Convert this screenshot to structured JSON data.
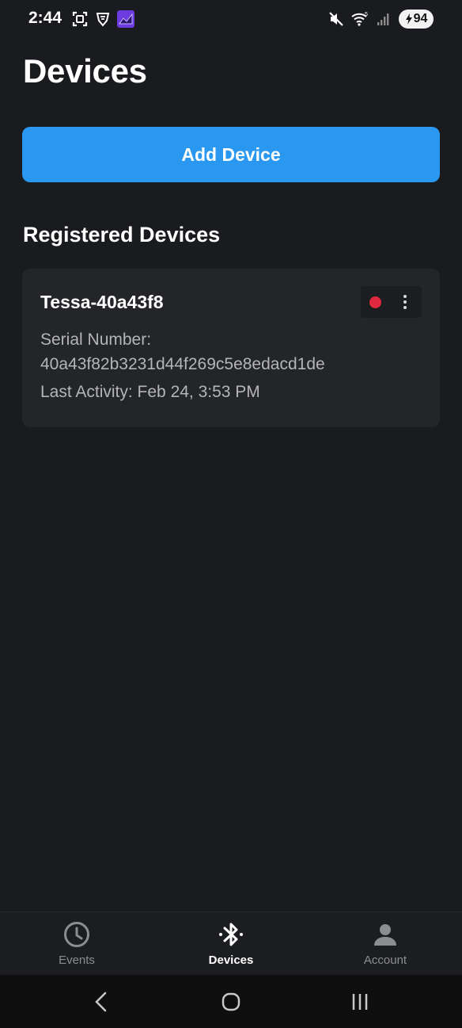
{
  "status_bar": {
    "time": "2:44",
    "battery": "94",
    "icons_left": [
      "screenshot-icon",
      "vpn-shield-icon",
      "app-chart-icon"
    ],
    "icons_right": [
      "mute-icon",
      "wifi-icon",
      "signal-icon",
      "battery-charging-icon"
    ],
    "wifi_badge": "5"
  },
  "page": {
    "title": "Devices"
  },
  "add_button": {
    "label": "Add Device",
    "color": "#2a97f0"
  },
  "registered": {
    "heading": "Registered Devices",
    "devices": [
      {
        "name": "Tessa-40a43f8",
        "serial_label": "Serial Number:",
        "serial_value": "40a43f82b3231d44f269c5e8edacd1de",
        "last_activity": "Last Activity: Feb 24, 3:53 PM",
        "status_color": "#e0283e"
      }
    ]
  },
  "bottom_nav": {
    "items": [
      {
        "label": "Events",
        "icon": "clock-icon",
        "active": false
      },
      {
        "label": "Devices",
        "icon": "bluetooth-icon",
        "active": true
      },
      {
        "label": "Account",
        "icon": "person-icon",
        "active": false
      }
    ]
  },
  "system_nav": {
    "buttons": [
      "back-icon",
      "home-icon",
      "recents-icon"
    ]
  }
}
